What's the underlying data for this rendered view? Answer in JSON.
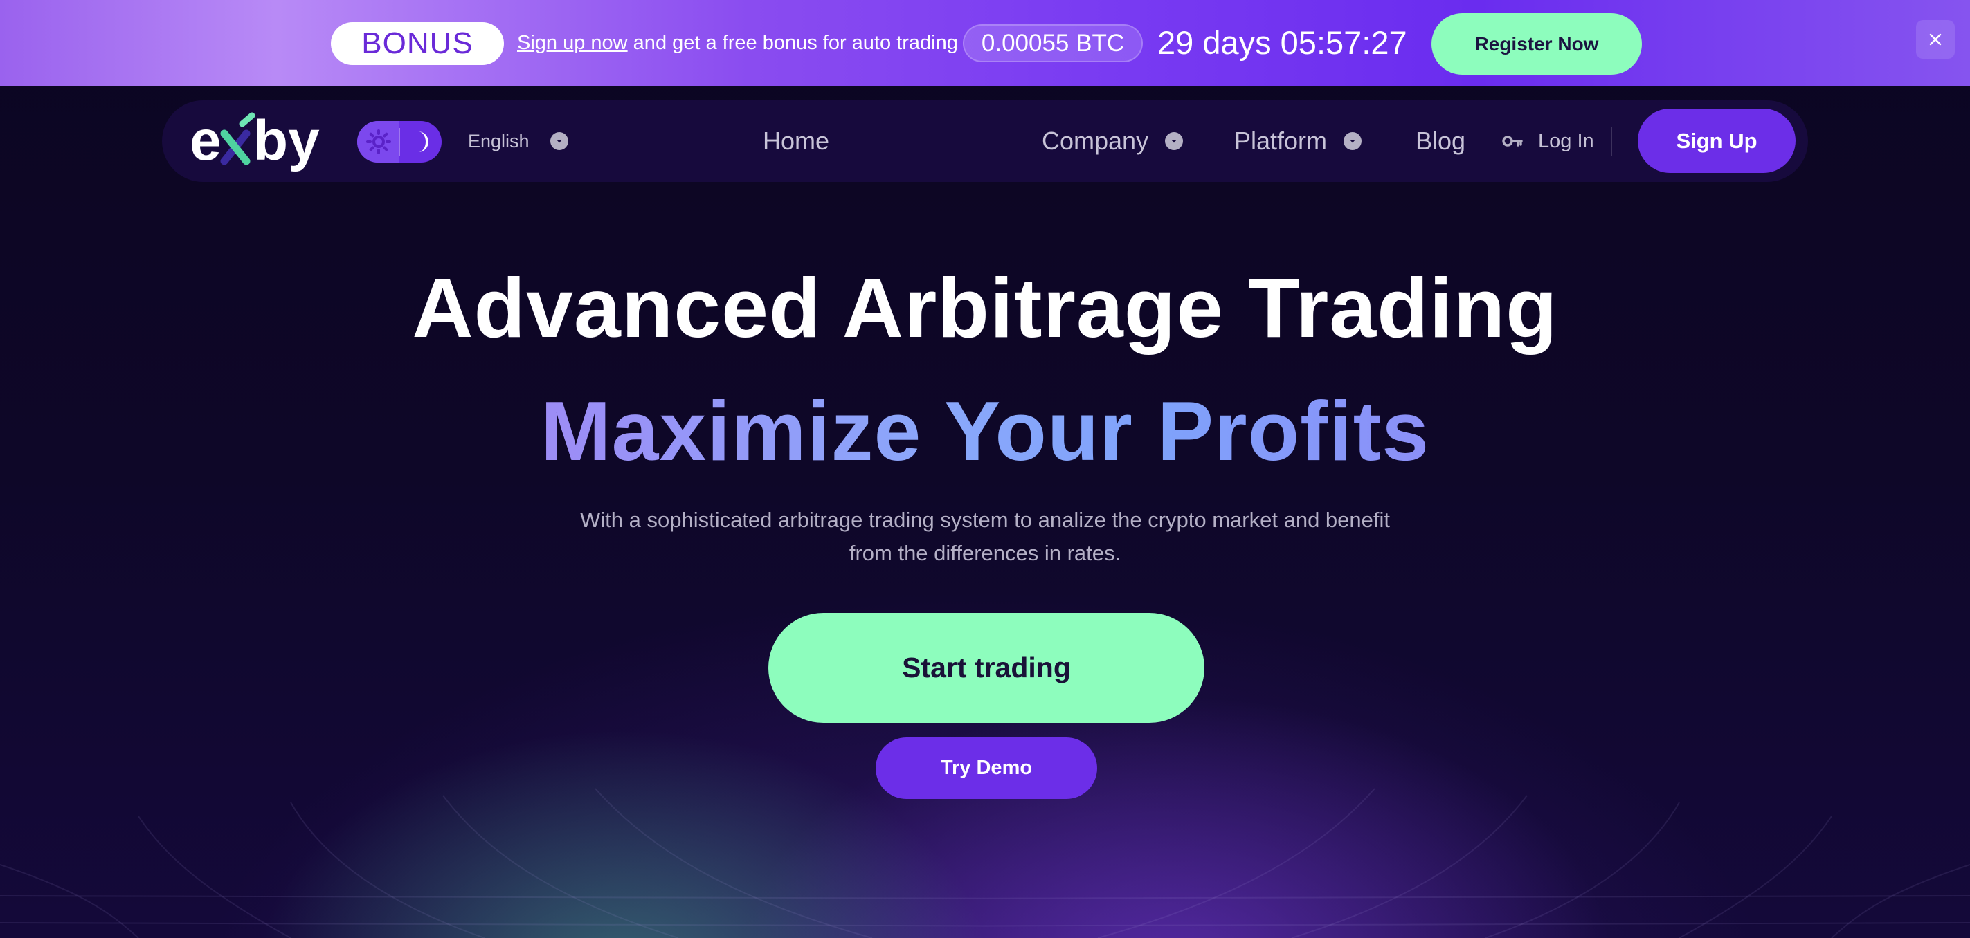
{
  "promo": {
    "bonus_label": "BONUS",
    "signup_link": "Sign up now",
    "text": " and get a free bonus for auto trading",
    "btc_amount": "0.00055 BTC",
    "countdown": "29 days 05:57:27",
    "register_label": "Register Now",
    "close_icon": "close-icon"
  },
  "nav": {
    "logo_text": "exby",
    "theme_icons": [
      "sun-icon",
      "moon-icon"
    ],
    "language": "English",
    "links": [
      {
        "label": "Home"
      },
      {
        "label": "Company"
      },
      {
        "label": "Platform"
      },
      {
        "label": "Blog"
      }
    ],
    "login_label": "Log In",
    "login_icon": "key-icon",
    "signup_label": "Sign Up"
  },
  "hero": {
    "title": "Advanced Arbitrage Trading",
    "subtitle": "Maximize Your Profits",
    "description": "With a sophisticated arbitrage trading system to analize the crypto market and benefit from the differences in rates.",
    "start_label": "Start trading",
    "demo_label": "Try Demo"
  },
  "colors": {
    "accent_green": "#8dfdbd",
    "accent_purple": "#6c2ee8",
    "background": "#0d0625"
  }
}
